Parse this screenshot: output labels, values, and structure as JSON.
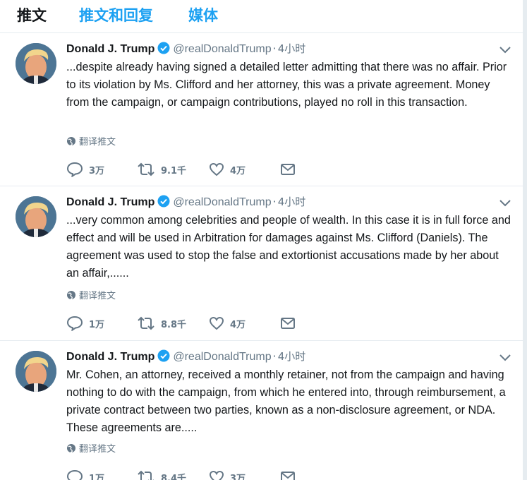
{
  "tabs": [
    {
      "label": "推文"
    },
    {
      "label": "推文和回复"
    },
    {
      "label": "媒体"
    }
  ],
  "colors": {
    "accent": "#1da1f2",
    "text": "#14171a",
    "muted": "#657786",
    "divider": "#e6ecf0"
  },
  "tweets": [
    {
      "name": "Donald J. Trump",
      "handle": "@realDonaldTrump",
      "dot": "·",
      "time": "4小时",
      "text": "...despite already having signed a detailed letter admitting that there was no affair. Prior to its violation by Ms. Clifford and her attorney, this was a private agreement. Money from the campaign, or campaign contributions, played no roll in this transaction.",
      "translate": "翻译推文",
      "replies": "3万",
      "retweets": "9.1千",
      "likes": "4万"
    },
    {
      "name": "Donald J. Trump",
      "handle": "@realDonaldTrump",
      "dot": "·",
      "time": "4小时",
      "text": "...very common among celebrities and people of wealth. In this case it is in full force and effect and will be used in Arbitration for damages against Ms. Clifford (Daniels). The agreement was used to stop the false and extortionist accusations made by her about an affair,......",
      "translate": "翻译推文",
      "replies": "1万",
      "retweets": "8.8千",
      "likes": "4万"
    },
    {
      "name": "Donald J. Trump",
      "handle": "@realDonaldTrump",
      "dot": "·",
      "time": "4小时",
      "text": "Mr. Cohen, an attorney, received a monthly retainer, not from the campaign and having nothing to do with the campaign, from which he entered into, through reimbursement, a private contract between two parties, known as a non-disclosure agreement, or NDA. These agreements are.....",
      "translate": "翻译推文",
      "replies": "1万",
      "retweets": "8.4千",
      "likes": "3万"
    }
  ]
}
